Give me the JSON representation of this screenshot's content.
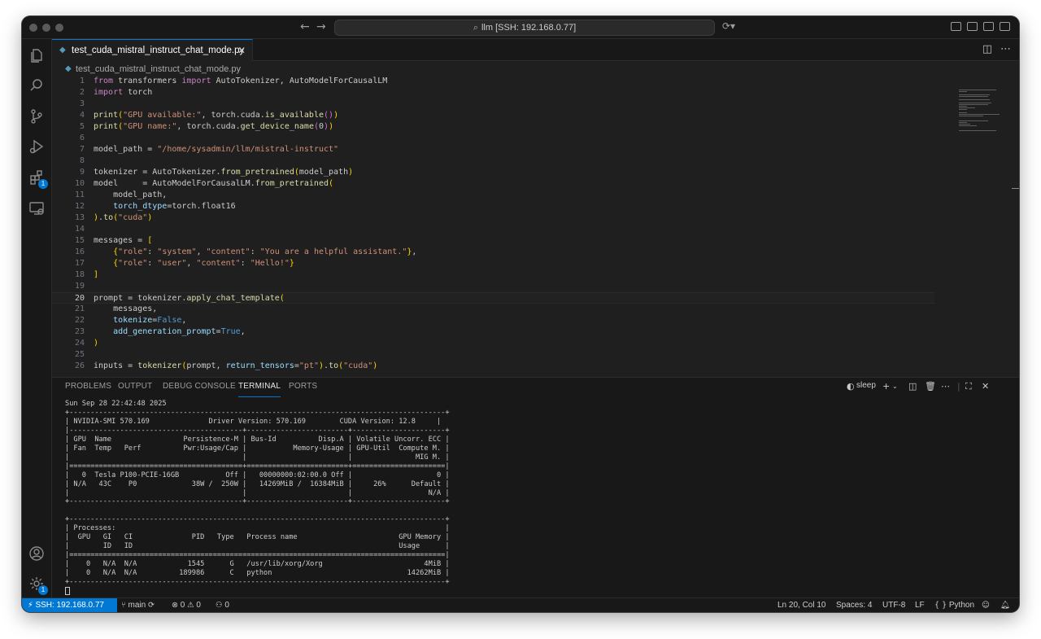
{
  "titlebar": {
    "command_center": "llm [SSH: 192.168.0.77]"
  },
  "activity_bar": {
    "extensions_badge": "1",
    "settings_badge": "1"
  },
  "tab": {
    "label": "test_cuda_mistral_instruct_chat_mode.py"
  },
  "breadcrumb": {
    "file": "test_cuda_mistral_instruct_chat_mode.py"
  },
  "editor": {
    "current_line": 20,
    "line_numbers": [
      "1",
      "2",
      "3",
      "4",
      "5",
      "6",
      "7",
      "8",
      "9",
      "10",
      "11",
      "12",
      "13",
      "14",
      "15",
      "16",
      "17",
      "18",
      "19",
      "20",
      "21",
      "22",
      "23",
      "24",
      "25",
      "26"
    ],
    "lines": [
      "from transformers import AutoTokenizer, AutoModelForCausalLM",
      "import torch",
      "",
      "print(\"GPU available:\", torch.cuda.is_available())",
      "print(\"GPU name:\", torch.cuda.get_device_name(0))",
      "",
      "model_path = \"/home/sysadmin/llm/mistral-instruct\"",
      "",
      "tokenizer = AutoTokenizer.from_pretrained(model_path)",
      "model     = AutoModelForCausalLM.from_pretrained(",
      "    model_path,",
      "    torch_dtype=torch.float16",
      ").to(\"cuda\")",
      "",
      "messages = [",
      "    {\"role\": \"system\", \"content\": \"You are a helpful assistant.\"},",
      "    {\"role\": \"user\", \"content\": \"Hello!\"}",
      "]",
      "",
      "prompt = tokenizer.apply_chat_template(",
      "    messages,",
      "    tokenize=False,",
      "    add_generation_prompt=True,",
      ")",
      "",
      "inputs = tokenizer(prompt, return_tensors=\"pt\").to(\"cuda\")"
    ]
  },
  "panel": {
    "tabs": [
      "PROBLEMS",
      "OUTPUT",
      "DEBUG CONSOLE",
      "TERMINAL",
      "PORTS"
    ],
    "active_tab": "TERMINAL",
    "terminal_name": "sleep",
    "terminal_lines": [
      "Sun Sep 28 22:42:48 2025",
      "+-----------------------------------------------------------------------------------------+",
      "| NVIDIA-SMI 570.169              Driver Version: 570.169        CUDA Version: 12.8     |",
      "|-----------------------------------------+------------------------+----------------------+",
      "| GPU  Name                 Persistence-M | Bus-Id          Disp.A | Volatile Uncorr. ECC |",
      "| Fan  Temp   Perf          Pwr:Usage/Cap |           Memory-Usage | GPU-Util  Compute M. |",
      "|                                         |                        |               MIG M. |",
      "|=========================================+========================+======================|",
      "|   0  Tesla P100-PCIE-16GB           Off |   00000000:02:00.0 Off |                    0 |",
      "| N/A   43C    P0             38W /  250W |   14269MiB /  16384MiB |     26%      Default |",
      "|                                         |                        |                  N/A |",
      "+-----------------------------------------+------------------------+----------------------+",
      "",
      "+-----------------------------------------------------------------------------------------+",
      "| Processes:                                                                              |",
      "|  GPU   GI   CI              PID   Type   Process name                        GPU Memory |",
      "|        ID   ID                                                               Usage      |",
      "|=========================================================================================|",
      "|    0   N/A  N/A            1545      G   /usr/lib/xorg/Xorg                        4MiB |",
      "|    0   N/A  N/A          189986      C   python                                14262MiB |",
      "+-----------------------------------------------------------------------------------------+"
    ]
  },
  "statusbar": {
    "remote": "SSH: 192.168.0.77",
    "branch": "main",
    "errors": "0",
    "warnings": "0",
    "ports": "0",
    "position": "Ln 20, Col 10",
    "spaces": "Spaces: 4",
    "encoding": "UTF-8",
    "eol": "LF",
    "language": "Python"
  },
  "colors": {
    "accent": "#0078d4",
    "editor_bg": "#1f1f1f",
    "chrome_bg": "#181818"
  }
}
